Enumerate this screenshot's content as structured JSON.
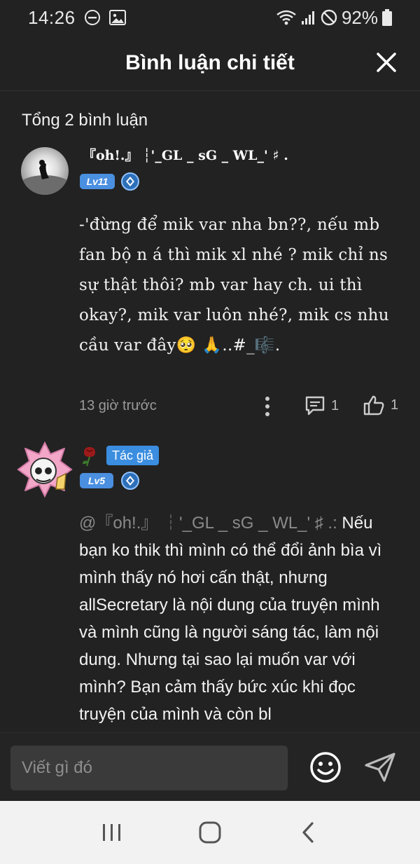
{
  "status_bar": {
    "time": "14:26",
    "battery": "92%"
  },
  "header": {
    "title": "Bình luận chi tiết"
  },
  "comments_summary": "Tổng 2 bình luận",
  "comments": [
    {
      "username": "『oh!.』 ┆'_GL _ sG _ WL_' ♯ .",
      "level": "Lv11",
      "text": "-'đừng để mik var nha bn??, nếu mb fan bộ n á thì mik xl nhé ? mik chỉ ns sự thật thôi? mb var hay ch. ui thì okay?, mik var luôn nhé?, mik cs nhu cầu var đây🥺 🙏..#_🎼.",
      "time": "13 giờ trước",
      "reply_count": "1",
      "like_count": "1"
    },
    {
      "author_badge": "Tác giả",
      "level": "Lv5",
      "mention": "@『oh!.』 ┆'_GL _ sG _ WL_' ♯ .:",
      "text": " Nếu bạn ko thik thì mình có thể đổi ảnh bìa vì mình thấy nó hơi cấn thật, nhưng allSecretary là nội dung của truyện mình và mình cũng là người sáng tác, làm nội dung. Nhưng tại sao lại muốn var với mình? Bạn cảm thấy bức xúc khi đọc truyện của mình và còn bl"
    }
  ],
  "input": {
    "placeholder": "Viết gì đó"
  },
  "icons": {
    "close": "close-icon",
    "emoji": "smiley-icon",
    "send": "send-icon",
    "more": "more-vertical-icon",
    "reply": "comment-icon",
    "like": "thumbs-up-icon"
  },
  "colors": {
    "background": "#222222",
    "accent": "#3b8de0",
    "muted": "#9a9a9a"
  }
}
